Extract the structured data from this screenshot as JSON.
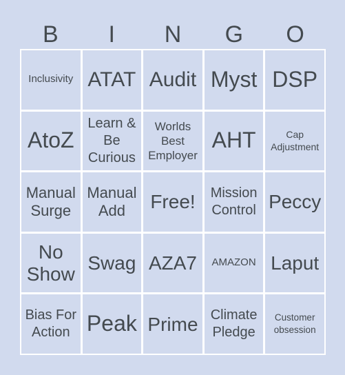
{
  "header": [
    "B",
    "I",
    "N",
    "G",
    "O"
  ],
  "cells": [
    [
      "Inclusivity",
      "ATAT",
      "Audit",
      "Myst",
      "DSP"
    ],
    [
      "AtoZ",
      "Learn & Be Curious",
      "Worlds Best Employer",
      "AHT",
      "Cap Adjustment"
    ],
    [
      "Manual Surge",
      "Manual Add",
      "Free!",
      "Mission Control",
      "Peccy"
    ],
    [
      "No Show",
      "Swag",
      "AZA7",
      "AMAZON",
      "Laput"
    ],
    [
      "Bias For Action",
      "Peak",
      "Prime",
      "Climate Pledge",
      "Customer obsession"
    ]
  ],
  "colors": {
    "background": "#d1daee",
    "grid_lines": "#ffffff",
    "text": "#444a4f"
  }
}
